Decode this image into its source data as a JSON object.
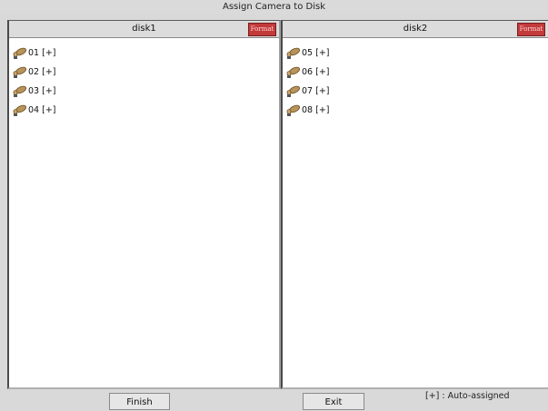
{
  "window": {
    "title": "Assign Camera to Disk"
  },
  "disks": [
    {
      "name": "disk1",
      "format_label": "Format",
      "cameras": [
        "01 [+]",
        "02 [+]",
        "03 [+]",
        "04 [+]"
      ]
    },
    {
      "name": "disk2",
      "format_label": "Format",
      "cameras": [
        "05 [+]",
        "06 [+]",
        "07 [+]",
        "08 [+]"
      ]
    }
  ],
  "footer": {
    "finish_label": "Finish",
    "exit_label": "Exit",
    "legend": "[+] : Auto-assigned"
  },
  "colors": {
    "format_button": "#c23a3a",
    "camera_icon": "#b8935a"
  },
  "icons": {
    "camera": "camera-icon"
  }
}
